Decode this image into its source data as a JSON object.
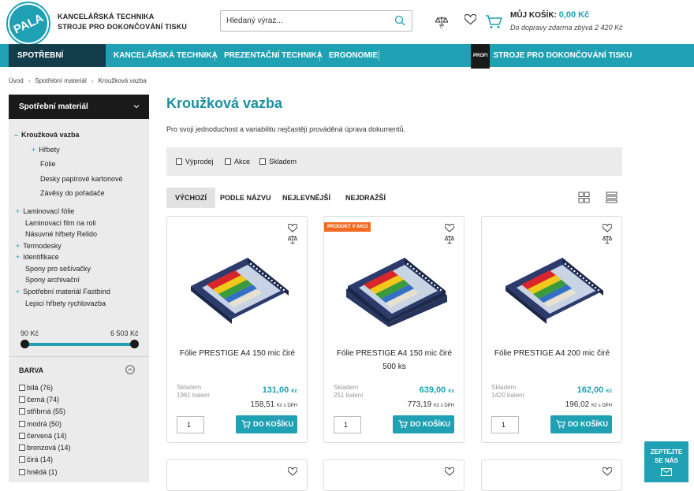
{
  "brand": {
    "line1": "KANCELÁŘSKÁ TECHNIKA",
    "line2": "STROJE PRO DOKONČOVÁNÍ TISKU",
    "logo_text": "PALA"
  },
  "search": {
    "placeholder": "Hledaný výraz..."
  },
  "compare": {
    "count": "0"
  },
  "cart": {
    "label": "MŮJ KOŠÍK:",
    "total": "0,00 Kč",
    "note": "Do dopravy zdarma zbývá 2 420 Kč"
  },
  "nav": {
    "items": [
      "SPOTŘEBNÍ MATERIÁL",
      "KANCELÁŘSKÁ TECHNIKA",
      "PREZENTAČNÍ TECHNIKA",
      "ERGONOMIE"
    ],
    "profi_badge": "PROFI",
    "profi_label": "STROJE PRO DOKONČOVÁNÍ TISKU"
  },
  "breadcrumb": [
    "Úvod",
    "Spotřební materiál",
    "Kroužková vazba"
  ],
  "sidebar": {
    "title": "Spotřební materiál",
    "categories": [
      {
        "mark": "–",
        "label": "Kroužková vazba"
      },
      {
        "mark": "+",
        "label": "Hřbety"
      },
      {
        "mark": "",
        "label": "Fólie"
      },
      {
        "mark": "",
        "label": "Desky papírové kartonové"
      },
      {
        "mark": "",
        "label": "Závěsy do pořadače"
      },
      {
        "mark": "+",
        "label": "Laminovací fólie"
      },
      {
        "mark": "",
        "label": "Laminovací film na roli"
      },
      {
        "mark": "",
        "label": "Násuvné hřbety Relido"
      },
      {
        "mark": "+",
        "label": "Termodesky"
      },
      {
        "mark": "+",
        "label": "Identifikace"
      },
      {
        "mark": "",
        "label": "Spony pro sešívačky"
      },
      {
        "mark": "",
        "label": "Spony archivační"
      },
      {
        "mark": "+",
        "label": "Spotřební materiál Fastbind"
      },
      {
        "mark": "",
        "label": "Lepicí hřbety rychlovazba"
      }
    ],
    "price_min": "90 Kč",
    "price_max": "6 503 Kč",
    "color_heading": "BARVA",
    "colors": [
      "bílá (76)",
      "černá (74)",
      "stříbrná (55)",
      "modrá (50)",
      "červená (14)",
      "bronzová (14)",
      "čirá (14)",
      "hnědá (1)"
    ]
  },
  "main": {
    "title": "Kroužková vazba",
    "description": "Pro svoji jednoduchost a variabilitu nejčastěji prováděná úprava dokumentů.",
    "filters": [
      "Výprodej",
      "Akce",
      "Skladem"
    ],
    "sort": [
      "VÝCHOZÍ",
      "PODLE NÁZVU",
      "NEJLEVNĚJŠÍ",
      "NEJDRAŽŠÍ"
    ]
  },
  "products": [
    {
      "badge": "",
      "name": "Fólie PRESTIGE A4 150 mic čiré",
      "stock": "Skladem",
      "stock_qty": "1961 balení",
      "price": "131,00",
      "vat_price": "158,51",
      "qty": "1"
    },
    {
      "badge": "PRODUKT V AKCI",
      "name": "Fólie PRESTIGE A4 150 mic čiré 500 ks",
      "stock": "Skladem",
      "stock_qty": "251 balení",
      "price": "639,00",
      "vat_price": "773,19",
      "qty": "1"
    },
    {
      "badge": "",
      "name": "Fólie PRESTIGE A4 200 mic čiré",
      "stock": "Skladem",
      "stock_qty": "1420 balení",
      "price": "162,00",
      "vat_price": "196,02",
      "qty": "1"
    }
  ],
  "price_unit": "Kč",
  "vat_unit": "Kč s DPH",
  "add_to_cart": "DO KOŠÍKU",
  "ask": {
    "line1": "ZEPTEJTE",
    "line2": "SE NÁS"
  },
  "colors": {
    "accent": "#1fa0b3",
    "dark": "#143d4b",
    "badge": "#f26a21"
  }
}
